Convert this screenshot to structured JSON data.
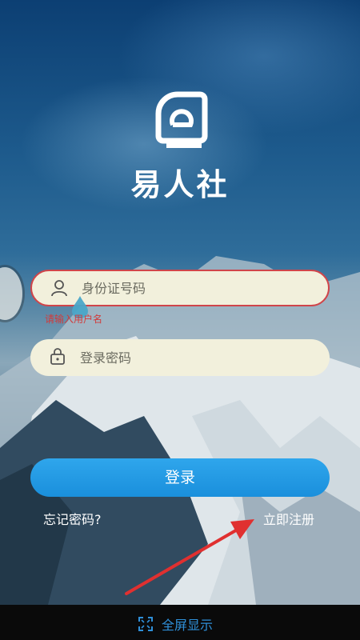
{
  "app": {
    "name": "易人社"
  },
  "login": {
    "id_placeholder": "身份证号码",
    "password_placeholder": "登录密码",
    "error_text": "请输入用户名",
    "login_button": "登录",
    "forgot_password": "忘记密码?",
    "register": "立即注册"
  },
  "bottom_bar": {
    "fullscreen_label": "全屏显示"
  },
  "icons": {
    "logo": "app-logo",
    "user": "user-icon",
    "lock": "lock-icon",
    "fullscreen": "fullscreen-icon"
  },
  "colors": {
    "accent": "#2196e3",
    "error": "#d0454a",
    "field_bg": "#f2f0dc",
    "annotation_arrow": "#e03030"
  }
}
